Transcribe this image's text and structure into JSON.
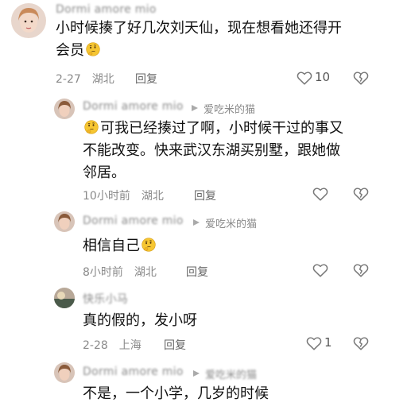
{
  "comments": [
    {
      "username": "Dormi amore mio",
      "text": "小时候揍了好几次刘天仙，现在想看她还得开会员",
      "text_line1": "小时候揍了好几次刘天仙，现在想看她还得开",
      "text_line2": "会员",
      "date": "2-27",
      "location": "湖北",
      "reply_label": "回复",
      "likes": "10",
      "emoji_after_text": "thinking-face-emoji"
    },
    {
      "username": "Dormi amore mio",
      "reply_to": "爱吃米的猫",
      "text_line1": "可我已经揍过了啊，小时候干过的事又",
      "text_line2": "不能改变。快来武汉东湖买别墅，跟她做",
      "text_line3": "邻居。",
      "date": "10小时前",
      "location": "湖北",
      "reply_label": "回复",
      "likes": ""
    },
    {
      "username": "Dormi amore mio",
      "reply_to": "爱吃米的猫",
      "text": "相信自己",
      "date": "8小时前",
      "location": "湖北",
      "reply_label": "回复",
      "likes": ""
    },
    {
      "username": "快乐小马",
      "text": "真的假的，发小呀",
      "date": "2-28",
      "location": "上海",
      "reply_label": "回复",
      "likes": "1"
    },
    {
      "username": "Dormi amore mio",
      "reply_to": "爱吃米的猫",
      "text": "不是，一个小学，几岁的时候"
    }
  ],
  "icons": {
    "like": "heart-outline-icon",
    "dislike": "broken-heart-icon",
    "reply_arrow": "triangle-right-icon",
    "emoji": "thinking-face-emoji"
  },
  "colors": {
    "meta_gray": "#8a8a8a",
    "text": "#111111",
    "background": "#ffffff"
  }
}
